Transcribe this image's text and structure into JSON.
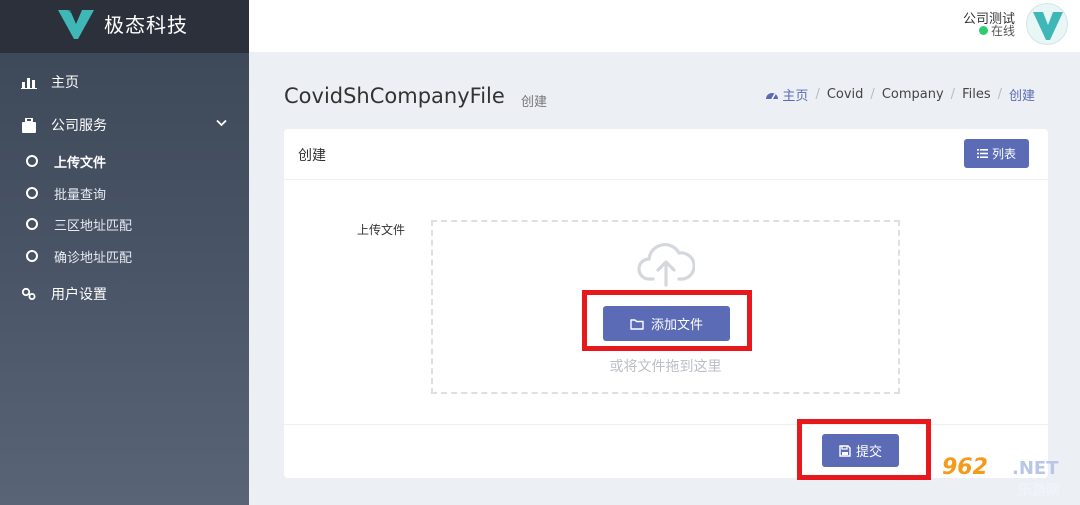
{
  "brand": {
    "name": "极态科技",
    "accent": "#3fb7b7"
  },
  "header": {
    "user_name": "公司测试",
    "status": "在线",
    "status_color": "#2ecc71"
  },
  "sidebar": {
    "items": [
      {
        "label": "主页",
        "icon": "bar-chart-icon"
      },
      {
        "label": "公司服务",
        "icon": "briefcase-icon",
        "expanded": true,
        "children": [
          {
            "label": "上传文件",
            "active": true
          },
          {
            "label": "批量查询"
          },
          {
            "label": "三区地址匹配"
          },
          {
            "label": "确诊地址匹配"
          }
        ]
      },
      {
        "label": "用户设置",
        "icon": "users-gear-icon"
      }
    ]
  },
  "page": {
    "title": "CovidShCompanyFile",
    "subtitle": "创建",
    "breadcrumb": {
      "home": "主页",
      "items": [
        "Covid",
        "Company",
        "Files"
      ],
      "current": "创建"
    }
  },
  "card": {
    "title": "创建",
    "list_button": "列表",
    "upload_label": "上传文件",
    "add_file_button": "添加文件",
    "drop_hint": "或将文件拖到这里",
    "submit_button": "提交"
  },
  "colors": {
    "primary": "#5b6bb5",
    "highlight": "#e8191c"
  },
  "watermark": {
    "number": "962",
    "suffix": ".NET",
    "site": "乐游网"
  }
}
